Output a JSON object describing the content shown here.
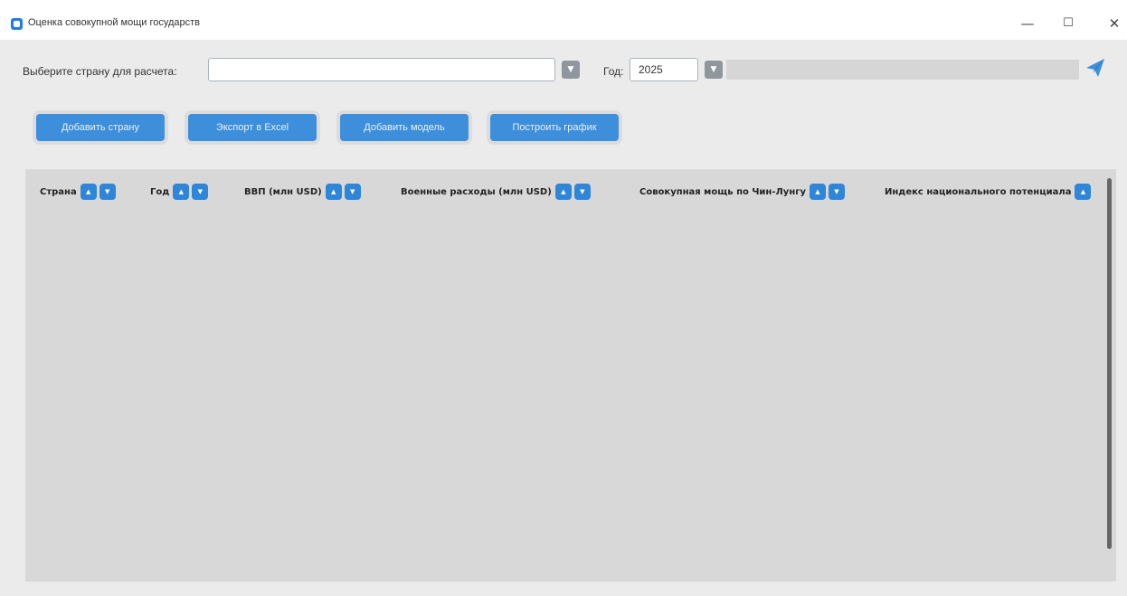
{
  "window": {
    "title": "Оценка совокупной мощи государств",
    "minimize": "—",
    "maximize": "☐",
    "close": "✕"
  },
  "form": {
    "country_label": "Выберите страну для расчета:",
    "country_value": "",
    "year_label": "Год:",
    "year_value": "2025",
    "dropdown_arrow": "▼"
  },
  "actions": {
    "add_country": "Добавить страну",
    "export_excel": "Экспорт в Excel",
    "add_model": "Добавить модель",
    "build_chart": "Построить график"
  },
  "table": {
    "columns": [
      "Страна",
      "Год",
      "ВВП (млн USD)",
      "Военные расходы (млн USD)",
      "Совокупная мощь по Чин-Лунгу",
      "Индекс национального потенциала"
    ],
    "sort_up": "▲",
    "sort_down": "▼"
  },
  "icons": {
    "app": "app-icon",
    "send": "paper-plane-icon",
    "accent_color": "#3d8edb"
  }
}
